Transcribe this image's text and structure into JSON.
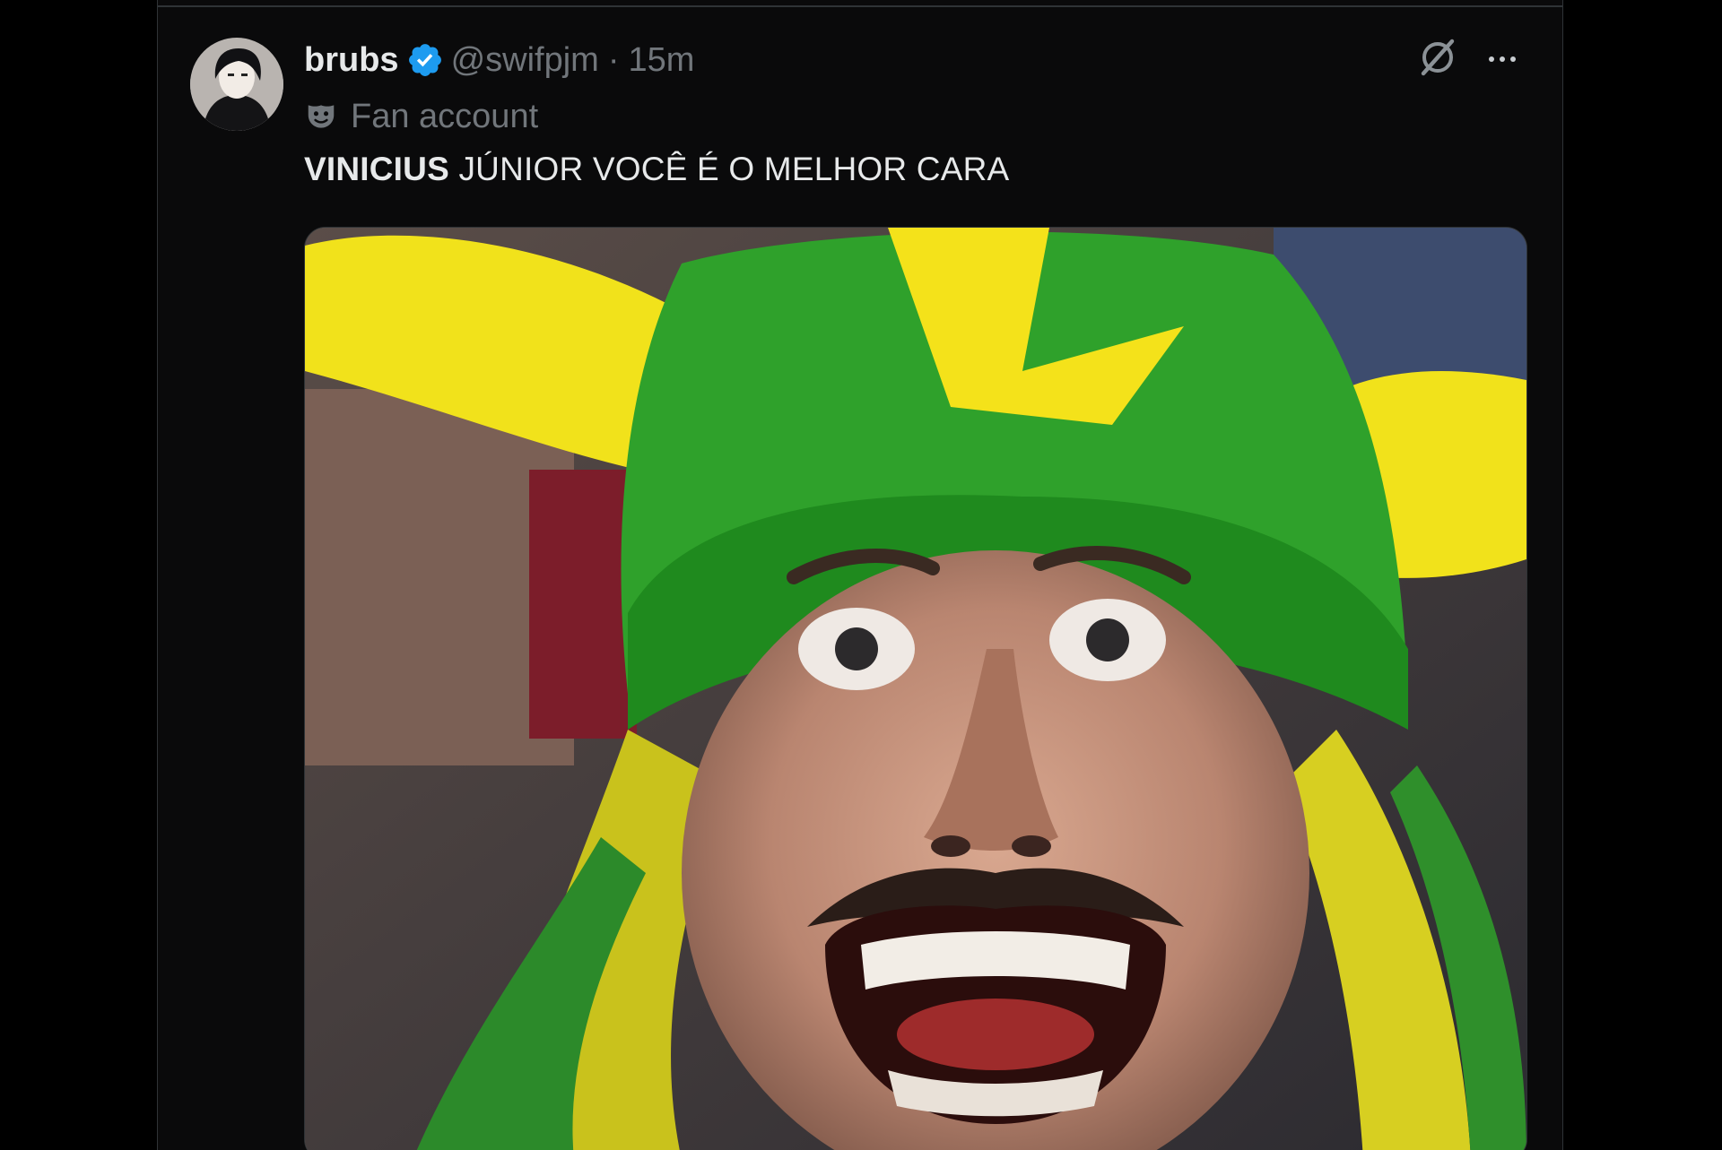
{
  "tweet": {
    "display_name": "brubs",
    "handle": "@swifpjm",
    "separator": "·",
    "time": "15m",
    "label": "Fan account",
    "text_bold": "VINICIUS",
    "text_rest": " JÚNIOR VOCÊ É O MELHOR CARA",
    "media_alt": "Fan in green and yellow Brazil horned hat with green and yellow wig, wide-eyed and screaming"
  },
  "icons": {
    "verified": "verified-badge-icon",
    "fan": "mask-icon",
    "grok": "grok-icon",
    "more": "more-icon"
  },
  "colors": {
    "background": "#000000",
    "panel": "#0a0a0b",
    "text": "#e7e9ea",
    "muted": "#71767b",
    "verified_blue": "#1d9bf0",
    "border": "#2f3336"
  }
}
